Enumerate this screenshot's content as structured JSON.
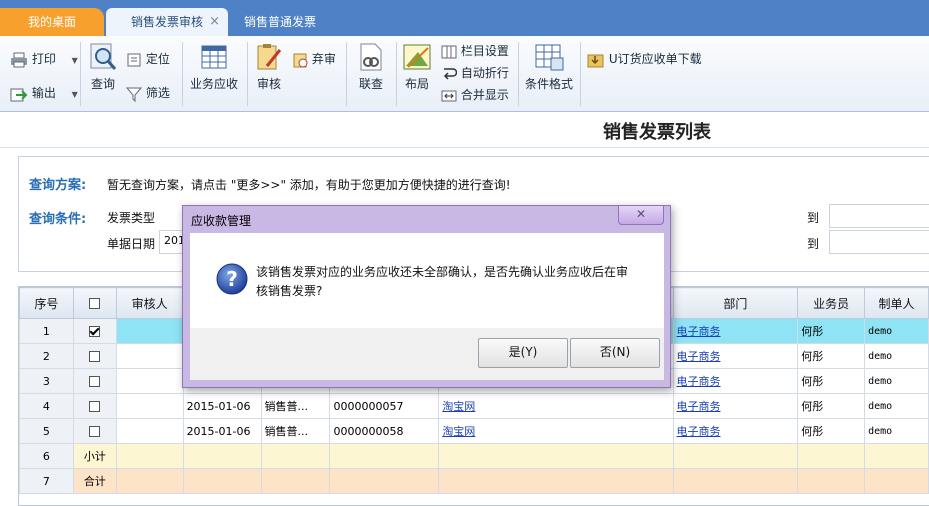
{
  "tabs": [
    {
      "label": "我的桌面"
    },
    {
      "label": "销售发票审核",
      "close": "×"
    },
    {
      "label": "销售普通发票"
    }
  ],
  "toolbar": {
    "print": "打印",
    "export": "输出",
    "query": "查询",
    "locate": "定位",
    "filter": "筛选",
    "biz_receivable": "业务应收",
    "audit": "审核",
    "abandon_audit": "弃审",
    "linked_query": "联查",
    "layout": "布局",
    "column_settings": "栏目设置",
    "auto_wrap": "自动折行",
    "merge_display": "合并显示",
    "conditional_format": "条件格式",
    "download": "U订货应收单下载"
  },
  "page_title": "销售发票列表",
  "query": {
    "scheme_label": "查询方案:",
    "scheme_text": "暂无查询方案，请点击 \"更多>>\" 添加，有助于您更加方便快捷的进行查询!",
    "cond_label": "查询条件:",
    "invoice_type": "发票类型",
    "doc_date": "单据日期",
    "doc_date_value": "201",
    "to1": "到",
    "to2": "到"
  },
  "grid": {
    "headers": [
      "序号",
      "",
      "审核人",
      "",
      "",
      "",
      "",
      "部门",
      "业务员",
      "制单人"
    ],
    "rows": [
      {
        "no": "1",
        "checked": true,
        "date": "",
        "type": "",
        "code": "",
        "cust": "",
        "dept": "电子商务",
        "sales": "何彤",
        "maker": "demo"
      },
      {
        "no": "2",
        "checked": false,
        "date": "",
        "type": "",
        "code": "",
        "cust": "",
        "dept": "电子商务",
        "sales": "何彤",
        "maker": "demo"
      },
      {
        "no": "3",
        "checked": false,
        "date": "",
        "type": "",
        "code": "",
        "cust": "",
        "dept": "电子商务",
        "sales": "何彤",
        "maker": "demo"
      },
      {
        "no": "4",
        "checked": false,
        "date": "2015-01-06",
        "type": "销售普...",
        "code": "0000000057",
        "cust": "淘宝网",
        "dept": "电子商务",
        "sales": "何彤",
        "maker": "demo"
      },
      {
        "no": "5",
        "checked": false,
        "date": "2015-01-06",
        "type": "销售普...",
        "code": "0000000058",
        "cust": "淘宝网",
        "dept": "电子商务",
        "sales": "何彤",
        "maker": "demo"
      }
    ],
    "subtotal": {
      "no": "6",
      "label": "小计"
    },
    "total": {
      "no": "7",
      "label": "合计"
    }
  },
  "dialog": {
    "title": "应收款管理",
    "message": "该销售发票对应的业务应收还未全部确认，是否先确认业务应收后在审核销售发票?",
    "yes": "是(Y)",
    "no": "否(N)",
    "icon": "question-icon"
  },
  "colors": {
    "tabbar": "#4f81c6",
    "home_tab": "#f7a02d",
    "selected_row": "#8ee3f4",
    "subtotal_row": "#fdf6d2",
    "total_row": "#fde3c8",
    "dialog_frame": "#c9b8e4"
  }
}
